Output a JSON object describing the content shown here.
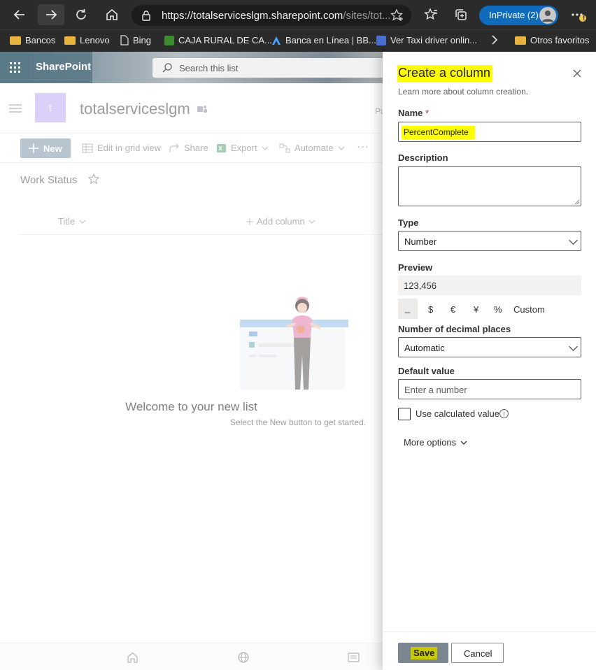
{
  "browser": {
    "url_main": "https://totalserviceslgm.sharepoint.com",
    "url_rest": "/sites/tot...",
    "inprivate_label": "InPrivate (2)",
    "notification_badge": "!",
    "favorites": [
      "Bancos",
      "Lenovo",
      "Bing",
      "CAJA RURAL DE CA...",
      "Banca en Línea | BB...",
      "Ver Taxi driver onlin...",
      "Otros favoritos"
    ]
  },
  "suite": {
    "app_name": "SharePoint",
    "search_placeholder": "Search this list"
  },
  "site": {
    "logo_letter": "t",
    "name": "totalserviceslgm",
    "header_right_fragment": "Pu"
  },
  "command_bar": {
    "new_label": "New",
    "grid_view_label": "Edit in grid view",
    "share_label": "Share",
    "export_label": "Export",
    "automate_label": "Automate",
    "more_label": "···"
  },
  "list": {
    "title": "Work Status",
    "col_title": "Title",
    "add_column": "Add column",
    "empty_title": "Welcome to your new list",
    "empty_subtitle": "Select the New button to get started."
  },
  "panel": {
    "title": "Create a column",
    "learn_more": "Learn more about column creation.",
    "name_label": "Name",
    "required_mark": "*",
    "name_value": "PercentComplete",
    "description_label": "Description",
    "type_label": "Type",
    "type_value": "Number",
    "preview_label": "Preview",
    "preview_value": "123,456",
    "format_options": [
      "_",
      "$",
      "€",
      "¥",
      "%",
      "Custom"
    ],
    "decimal_label": "Number of decimal places",
    "decimal_value": "Automatic",
    "default_label": "Default value",
    "default_placeholder": "Enter a number",
    "calc_label": "Use calculated value",
    "info_glyph": "i",
    "more_options": "More options",
    "save_label": "Save",
    "cancel_label": "Cancel"
  },
  "colors": {
    "highlight": "#ffff00",
    "save_button": "#7a8690",
    "site_logo": "#b4a0f8",
    "inprivate": "#0f6cbd",
    "new_button": "#8aa2b4"
  }
}
